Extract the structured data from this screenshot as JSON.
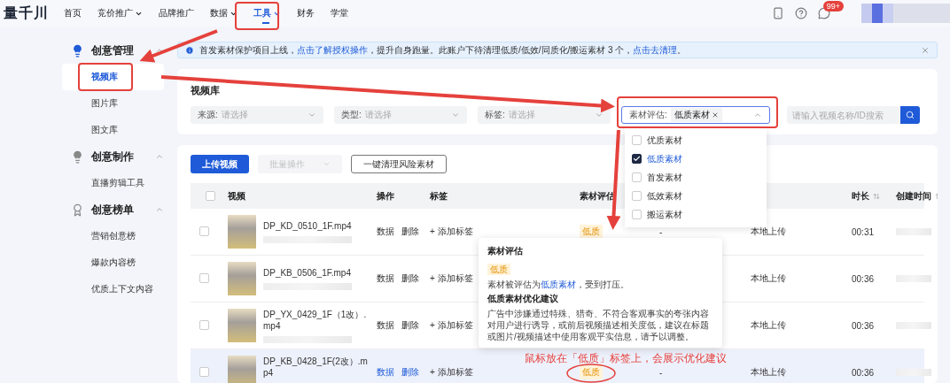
{
  "nav": {
    "logo": "量千川",
    "items": [
      {
        "label": "首页",
        "dropdown": false,
        "selected": false
      },
      {
        "label": "竞价推广",
        "dropdown": true,
        "selected": false
      },
      {
        "label": "品牌推广",
        "dropdown": false,
        "selected": false
      },
      {
        "label": "数据",
        "dropdown": true,
        "selected": false
      },
      {
        "label": "工具",
        "dropdown": true,
        "selected": true
      },
      {
        "label": "财务",
        "dropdown": false,
        "selected": false
      },
      {
        "label": "学堂",
        "dropdown": false,
        "selected": false
      }
    ],
    "badge": "99+"
  },
  "sidebar": {
    "groups": [
      {
        "title": "创意管理",
        "expanded": true,
        "items": [
          {
            "label": "视频库",
            "selected": true
          },
          {
            "label": "图片库",
            "selected": false
          },
          {
            "label": "图文库",
            "selected": false
          }
        ]
      },
      {
        "title": "创意制作",
        "expanded": true,
        "items": [
          {
            "label": "直播剪辑工具",
            "selected": false
          }
        ]
      },
      {
        "title": "创意榜单",
        "expanded": true,
        "items": [
          {
            "label": "营销创意榜",
            "selected": false
          },
          {
            "label": "爆款内容榜",
            "selected": false
          },
          {
            "label": "优质上下文内容",
            "selected": false
          }
        ]
      }
    ]
  },
  "banner": {
    "segments": [
      {
        "kind": "text",
        "text": "首发素材保护项目上线，"
      },
      {
        "kind": "link",
        "text": "点击了解授权操作"
      },
      {
        "kind": "text",
        "text": "，提升自身跑量。此账户下待清理低质/低效/同质化/搬运素材 3 个，"
      },
      {
        "kind": "link",
        "text": "点击去清理"
      },
      {
        "kind": "text",
        "text": "。"
      }
    ]
  },
  "filters": {
    "title": "视频库",
    "selects": [
      {
        "label": "来源:",
        "placeholder": "请选择"
      },
      {
        "label": "类型:",
        "placeholder": "请选择"
      },
      {
        "label": "标签:",
        "placeholder": "请选择"
      }
    ],
    "evaluation": {
      "label": "素材评估:",
      "tag": "低质素材",
      "expanded": true,
      "options": [
        {
          "label": "优质素材",
          "checked": false
        },
        {
          "label": "低质素材",
          "checked": true
        },
        {
          "label": "首发素材",
          "checked": false
        },
        {
          "label": "低效素材",
          "checked": false
        },
        {
          "label": "搬运素材",
          "checked": false
        }
      ]
    },
    "search": {
      "placeholder": "请输入视频名称/ID搜索"
    }
  },
  "toolbar": [
    {
      "label": "上传视频",
      "kind": "primary",
      "disabled": false
    },
    {
      "label": "批量操作",
      "kind": "select",
      "disabled": true
    },
    {
      "label": "一键清理风险素材",
      "kind": "outline",
      "disabled": false
    }
  ],
  "table": {
    "select_all": {
      "checked": false
    },
    "columns": [
      {
        "sortable": false
      },
      {
        "label": "视频",
        "sortable": false
      },
      {
        "label": "操作",
        "sortable": false
      },
      {
        "label": "标签",
        "sortable": false
      },
      {
        "label": "素材评估",
        "sortable": false
      },
      {},
      {},
      {
        "label": "时长",
        "sortable": true
      },
      {
        "label": "创建时间",
        "sortable": true
      }
    ],
    "rows": [
      {
        "checked": false,
        "name": "DP_KD_0510_1F.mp4",
        "actions": [
          "数据",
          "删除"
        ],
        "tag_action": "+ 添加标签",
        "evaluation": "低质",
        "column_6": "-",
        "column_7": "本地上传",
        "duration": "00:31",
        "hovered": false
      },
      {
        "checked": false,
        "name": "DP_KB_0506_1F.mp4",
        "actions": [
          "数据",
          "删除"
        ],
        "tag_action": "+ 添加标签",
        "column_7": "本地上传",
        "duration": "00:36",
        "hovered": false
      },
      {
        "checked": false,
        "name": "DP_YX_0429_1F（1改）.mp4",
        "actions": [
          "数据",
          "删除"
        ],
        "tag_action": "+ 添加标签",
        "column_7": "本地上传",
        "duration": "00:36",
        "hovered": false
      },
      {
        "checked": false,
        "name": "DP_KB_0428_1F(2改）.mp4",
        "actions": [
          "数据",
          "删除"
        ],
        "tag_action": "+ 添加标签",
        "evaluation": "低质",
        "column_6": "-",
        "column_7": "本地上传",
        "duration": "00:36",
        "hovered": true
      }
    ]
  },
  "popover": {
    "title": "素材评估",
    "tag": "低质",
    "desc": [
      {
        "kind": "text",
        "text": "素材被评估为"
      },
      {
        "kind": "link",
        "text": "低质素材"
      },
      {
        "kind": "text",
        "text": "，受到打压。"
      }
    ],
    "advice_title": "低质素材优化建议",
    "advice": "广告中涉嫌通过特殊、猎奇、不符合客观事实的夸张内容对用户进行诱导，或前后视频描述相关度低，建议在标题或图片/视频描述中使用客观平实信息，请予以调整。"
  },
  "annotation": "鼠标放在「低质」标签上，会展示优化建议"
}
